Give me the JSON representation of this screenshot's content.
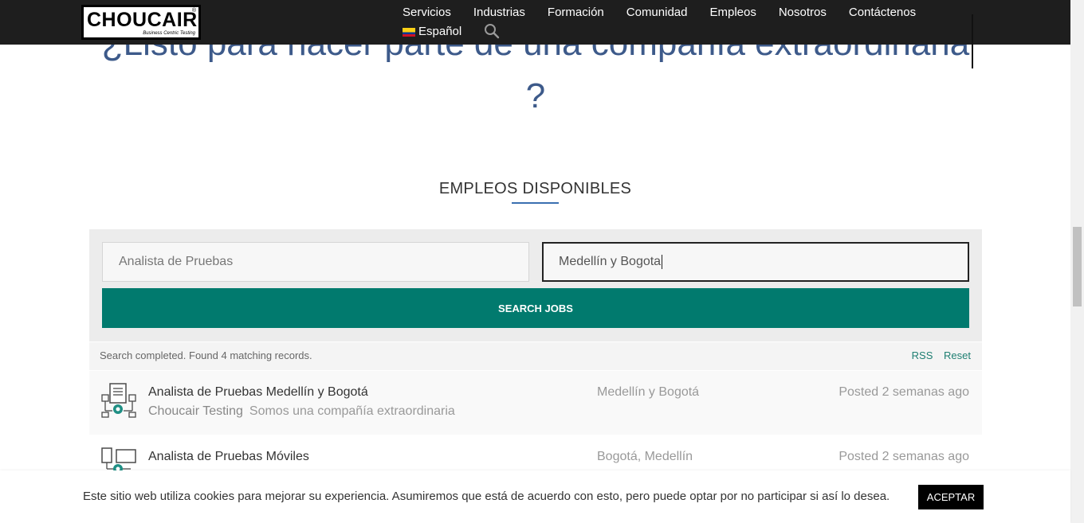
{
  "header": {
    "logo_text": "CHOUCAIR",
    "logo_tagline": "Business Centric Testing",
    "logo_reg": "®",
    "nav": [
      {
        "label": "Servicios"
      },
      {
        "label": "Industrias"
      },
      {
        "label": "Formación"
      },
      {
        "label": "Comunidad"
      },
      {
        "label": "Empleos"
      },
      {
        "label": "Nosotros"
      },
      {
        "label": "Contáctenos"
      }
    ],
    "language": "Español",
    "search_icon": "magnifier-icon"
  },
  "hero": {
    "title_line1": "¿Listo para hacer parte de una compañía extraordinaria",
    "title_line2": "?",
    "color": "#3d5a8a"
  },
  "section": {
    "title": "EMPLEOS DISPONIBLES",
    "underline_color": "#3a6fb0"
  },
  "search": {
    "keywords_placeholder": "Analista de Pruebas",
    "location_value": "Medellín y Bogota",
    "button_label": "SEARCH JOBS",
    "button_color": "#017a6e"
  },
  "results": {
    "status": "Search completed. Found 4 matching records.",
    "rss_label": "RSS",
    "reset_label": "Reset",
    "jobs": [
      {
        "title": "Analista de Pruebas Medellín y Bogotá",
        "company": "Choucair Testing",
        "tagline": "Somos una compañía extraordinaria",
        "location": "Medellín y Bogotá",
        "posted": "Posted 2 semanas ago",
        "icon": "document-gear-icon"
      },
      {
        "title": "Analista de Pruebas Móviles",
        "company": "",
        "tagline": "",
        "location": "Bogotá, Medellín",
        "posted": "Posted 2 semanas ago",
        "icon": "devices-gear-icon"
      }
    ]
  },
  "cookie": {
    "text": "Este sitio web utiliza cookies para mejorar su experiencia. Asumiremos que está de acuerdo con esto, pero puede optar por no participar si así lo desea.",
    "accept_label": "ACEPTAR"
  }
}
